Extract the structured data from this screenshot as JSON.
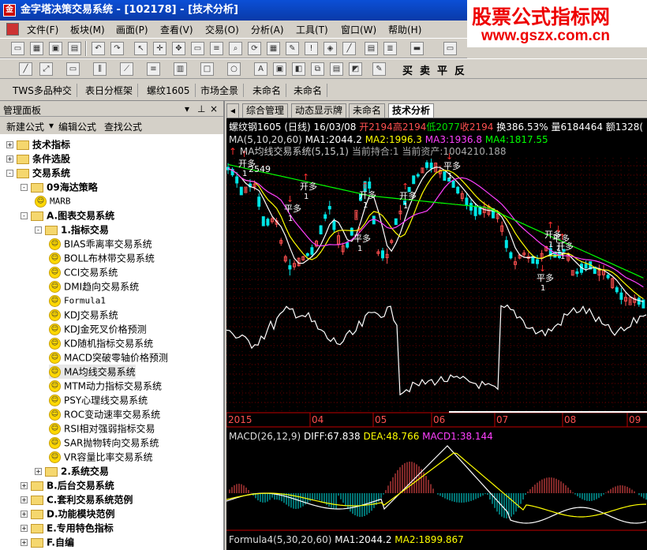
{
  "title": {
    "app": "金字塔决策交易系统",
    "code": "[102178]",
    "view": "[技术分析]"
  },
  "watermark": {
    "line1": "股票公式指标网",
    "line2": "www.gszx.com.cn"
  },
  "menu": [
    "文件(F)",
    "板块(M)",
    "画面(P)",
    "查看(V)",
    "交易(O)",
    "分析(A)",
    "工具(T)",
    "窗口(W)",
    "帮助(H)"
  ],
  "toolbar2": {
    "buy": "买",
    "sell": "卖",
    "flat": "平",
    "reverse": "反"
  },
  "quicktabs": [
    "TWS多品种交",
    "表日分框架",
    "螺纹1605",
    "市场全景",
    "未命名",
    "未命名"
  ],
  "panel": {
    "title": "管理面板",
    "new_formula": "新建公式",
    "edit_formula": "编辑公式",
    "find_formula": "查找公式"
  },
  "tree": [
    {
      "level": 0,
      "type": "folder",
      "label": "技术指标",
      "bold": true,
      "exp": "+"
    },
    {
      "level": 0,
      "type": "folder",
      "label": "条件选股",
      "bold": true,
      "exp": "+"
    },
    {
      "level": 0,
      "type": "folder",
      "label": "交易系统",
      "bold": true,
      "exp": "-"
    },
    {
      "level": 1,
      "type": "folder",
      "label": "09海达策略",
      "bold": true,
      "exp": "-"
    },
    {
      "level": 2,
      "type": "item",
      "label": "MARB",
      "mono": true
    },
    {
      "level": 1,
      "type": "folder",
      "label": "A.图表交易系统",
      "bold": true,
      "exp": "-"
    },
    {
      "level": 2,
      "type": "folder",
      "label": "1.指标交易",
      "bold": true,
      "exp": "-"
    },
    {
      "level": 3,
      "type": "item",
      "label": "BIAS乖离率交易系统"
    },
    {
      "level": 3,
      "type": "item",
      "label": "BOLL布林带交易系统"
    },
    {
      "level": 3,
      "type": "item",
      "label": "CCI交易系统"
    },
    {
      "level": 3,
      "type": "item",
      "label": "DMI趋向交易系统"
    },
    {
      "level": 3,
      "type": "item",
      "label": "Formula1",
      "mono": true
    },
    {
      "level": 3,
      "type": "item",
      "label": "KDJ交易系统"
    },
    {
      "level": 3,
      "type": "item",
      "label": "KDJ金死叉价格预测"
    },
    {
      "level": 3,
      "type": "item",
      "label": "KD随机指标交易系统"
    },
    {
      "level": 3,
      "type": "item",
      "label": "MACD突破零轴价格预测"
    },
    {
      "level": 3,
      "type": "item",
      "label": "MA均线交易系统",
      "selected": true
    },
    {
      "level": 3,
      "type": "item",
      "label": "MTM动力指标交易系统"
    },
    {
      "level": 3,
      "type": "item",
      "label": "PSY心理线交易系统"
    },
    {
      "level": 3,
      "type": "item",
      "label": "ROC变动速率交易系统"
    },
    {
      "level": 3,
      "type": "item",
      "label": "RSI相对强弱指标交易"
    },
    {
      "level": 3,
      "type": "item",
      "label": "SAR抛物转向交易系统"
    },
    {
      "level": 3,
      "type": "item",
      "label": "VR容量比率交易系统"
    },
    {
      "level": 2,
      "type": "folder",
      "label": "2.系统交易",
      "bold": true,
      "exp": "+"
    },
    {
      "level": 1,
      "type": "folder",
      "label": "B.后台交易系统",
      "bold": true,
      "exp": "+"
    },
    {
      "level": 1,
      "type": "folder",
      "label": "C.套利交易系统范例",
      "bold": true,
      "exp": "+"
    },
    {
      "level": 1,
      "type": "folder",
      "label": "D.功能模块范例",
      "bold": true,
      "exp": "+"
    },
    {
      "level": 1,
      "type": "folder",
      "label": "E.专用特色指标",
      "bold": true,
      "exp": "+"
    },
    {
      "level": 1,
      "type": "folder",
      "label": "F.自编",
      "bold": true,
      "exp": "+"
    }
  ],
  "chart_tabs": [
    "综合管理",
    "动态显示牌",
    "未命名",
    "技术分析"
  ],
  "quote": {
    "name": "螺纹钢1605 (日线) 16/03/08",
    "open": "开2194",
    "high": "高2194",
    "low": "低2077",
    "close": "收2194",
    "turnover": "换386.53%",
    "volume": "量6184464",
    "amount": "额1328("
  },
  "ma": {
    "label": "MA(5,10,20,60)",
    "ma1": "MA1:2044.2",
    "ma2": "MA2:1996.3",
    "ma3": "MA3:1936.8",
    "ma4": "MA4:1817.55"
  },
  "system": {
    "label": "MA均线交易系统(5,15,1)",
    "pos": "当前持合:1",
    "assets": "当前资产:1004210.188"
  },
  "price_label": "2549",
  "signals": {
    "buy": "开多",
    "sell": "平多",
    "qty": "1"
  },
  "xaxis": [
    "2015",
    "04",
    "05",
    "06",
    "07",
    "08",
    "09"
  ],
  "macd": {
    "label": "MACD(26,12,9)",
    "diff": "DIFF:67.838",
    "dea": "DEA:48.766",
    "macd1": "MACD1:38.144"
  },
  "formula4": {
    "label": "Formula4(5,30,20,60)",
    "ma1": "MA1:2044.2",
    "ma2": "MA2:1899.867"
  },
  "colors": {
    "up": "#ff5050",
    "down": "#00e5e5",
    "ma1": "#ffffff",
    "ma2": "#ffff00",
    "ma3": "#ff40ff",
    "ma4": "#00ff00"
  }
}
